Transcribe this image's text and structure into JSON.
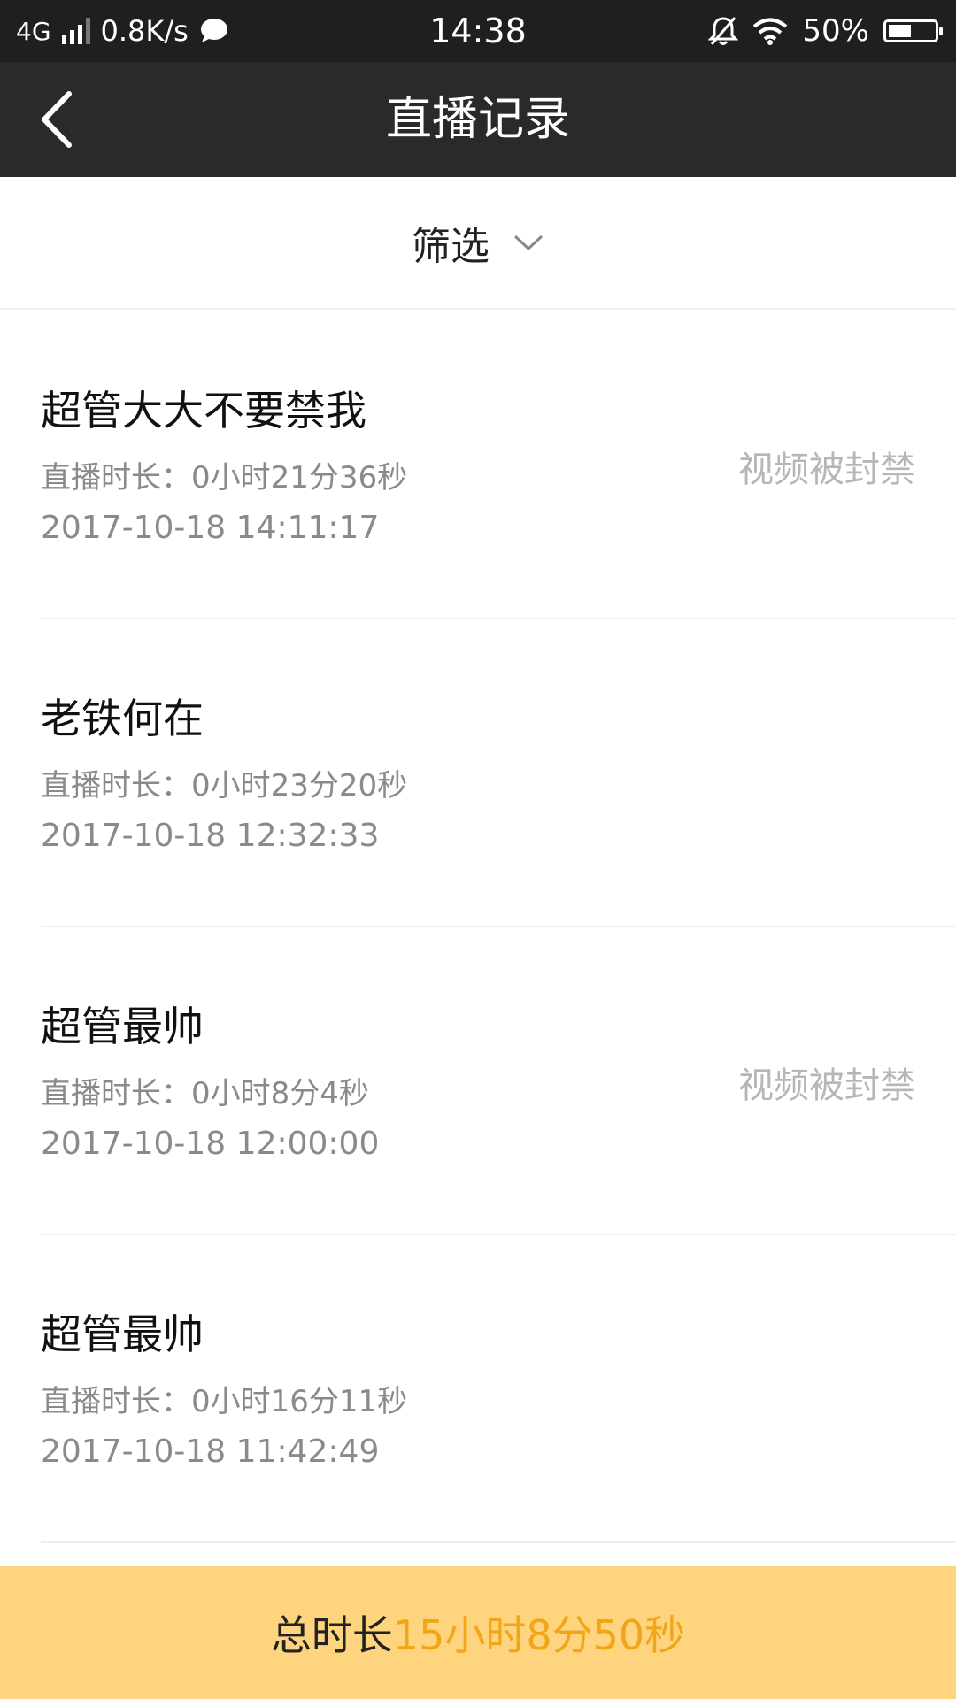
{
  "status_bar": {
    "network": "4G",
    "speed": "0.8K/s",
    "time": "14:38",
    "battery": "50%",
    "battery_level": 0.5
  },
  "nav": {
    "title": "直播记录"
  },
  "filter": {
    "label": "筛选"
  },
  "records": [
    {
      "name": "超管大大不要禁我",
      "duration": "直播时长：0小时21分36秒",
      "datetime": "2017-10-18 14:11:17",
      "status": "视频被封禁"
    },
    {
      "name": "老铁何在",
      "duration": "直播时长：0小时23分20秒",
      "datetime": "2017-10-18 12:32:33",
      "status": ""
    },
    {
      "name": "超管最帅",
      "duration": "直播时长：0小时8分4秒",
      "datetime": "2017-10-18 12:00:00",
      "status": "视频被封禁"
    },
    {
      "name": "超管最帅",
      "duration": "直播时长：0小时16分11秒",
      "datetime": "2017-10-18 11:42:49",
      "status": ""
    }
  ],
  "footer": {
    "label": "总时长",
    "value": "15小时8分50秒"
  },
  "colors": {
    "accent": "#f2a516",
    "footer_bg": "#fed57e",
    "nav_bg": "#2a2a2a"
  }
}
